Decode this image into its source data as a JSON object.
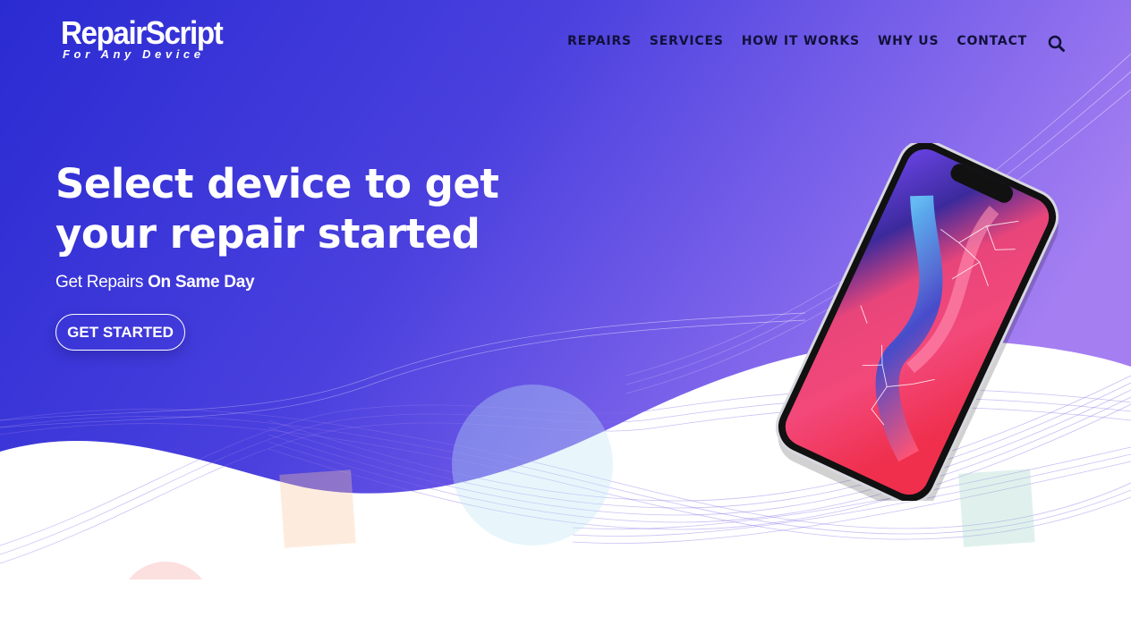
{
  "brand": {
    "name": "RepairScript",
    "tagline": "For Any Device"
  },
  "nav": {
    "items": [
      {
        "label": "REPAIRS"
      },
      {
        "label": "SERVICES"
      },
      {
        "label": "HOW IT WORKS"
      },
      {
        "label": "WHY US"
      },
      {
        "label": "CONTACT"
      }
    ],
    "search_icon": "search-icon"
  },
  "hero": {
    "headline_line1": "Select device to get",
    "headline_line2": "your repair started",
    "tagline_prefix": "Get Repairs",
    "tagline_bold": "On Same Day",
    "cta_label": "GET STARTED"
  },
  "colors": {
    "gradient_start": "#2b2dd4",
    "gradient_end": "#9f78f0",
    "nav_text": "#11113a",
    "accent_wave": "#8a6ee6"
  }
}
